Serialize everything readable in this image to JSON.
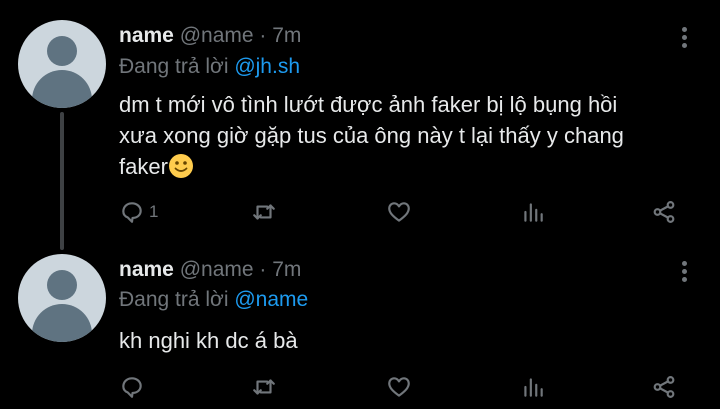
{
  "tweets": [
    {
      "name": "name",
      "handle": "@name",
      "dot": "·",
      "time": "7m",
      "reply_prefix": "Đang trả lời",
      "reply_to": "@jh.sh",
      "text_line1": "dm t mới vô tình lướt được ảnh faker bị lộ bụng hồi",
      "text_line2": "xưa xong giờ gặp tus của ông này t lại thấy y chang",
      "text_line3": "faker",
      "emoji": "slightly-smiling-face",
      "reply_count": "1"
    },
    {
      "name": "name",
      "handle": "@name",
      "dot": "·",
      "time": "7m",
      "reply_prefix": "Đang trả lời",
      "reply_to": "@name",
      "text_line1": "kh nghi kh dc á bà",
      "reply_count": ""
    }
  ],
  "icons": {
    "reply": "reply-icon",
    "retweet": "retweet-icon",
    "like": "heart-icon",
    "views": "analytics-icon",
    "share": "share-icon",
    "more": "more-vertical-icon"
  },
  "colors": {
    "background": "#000000",
    "text": "#e7e9ea",
    "muted": "#71767b",
    "mention": "#1d9bf0",
    "avatar_bg": "#ccd6dd",
    "avatar_fg": "#5f7381"
  }
}
